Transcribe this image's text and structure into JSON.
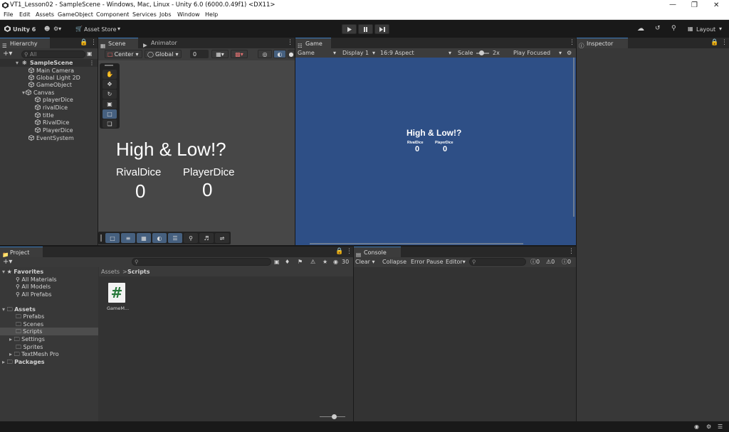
{
  "window": {
    "title": "VT1_Lesson02 - SampleScene - Windows, Mac, Linux - Unity 6.0 (6000.0.49f1) <DX11>"
  },
  "menu": [
    "File",
    "Edit",
    "Assets",
    "GameObject",
    "Component",
    "Services",
    "Jobs",
    "Window",
    "Help"
  ],
  "toolbar": {
    "unity_label": "Unity 6",
    "asset_store_label": "Asset Store",
    "layout_label": "Layout"
  },
  "hierarchy": {
    "tab_label": "Hierarchy",
    "search_placeholder": "All",
    "scene_name": "SampleScene",
    "items": [
      "Main Camera",
      "Global Light 2D",
      "GameObject",
      "Canvas",
      "playerDice",
      "rivalDice",
      "title",
      "RivalDice",
      "PlayerDice",
      "EventSystem"
    ]
  },
  "scene": {
    "tab_label": "Scene",
    "pivot_label": "Center",
    "space_label": "Global",
    "grid_value": "0",
    "title_text": "High & Low!?",
    "rival_label": "RivalDice",
    "player_label": "PlayerDice",
    "rival_value": "0",
    "player_value": "0"
  },
  "animator": {
    "tab_label": "Animator"
  },
  "game": {
    "tab_label": "Game",
    "mode_label": "Game",
    "display_label": "Display 1",
    "aspect_label": "16:9 Aspect",
    "scale_label": "Scale",
    "scale_value": "2x",
    "play_focus_label": "Play Focused",
    "bg_color": "#2e4f86"
  },
  "inspector": {
    "tab_label": "Inspector"
  },
  "project": {
    "tab_label": "Project",
    "hidden_count": "30",
    "breadcrumb_root": "Assets",
    "breadcrumb_sep": ">",
    "breadcrumb_current": "Scripts",
    "favorites_label": "Favorites",
    "favorites": [
      "All Materials",
      "All Models",
      "All Prefabs"
    ],
    "assets_label": "Assets",
    "asset_folders": [
      "Prefabs",
      "Scenes",
      "Scripts",
      "Settings",
      "Sprites",
      "TextMesh Pro"
    ],
    "packages_label": "Packages",
    "file_name": "GameM..."
  },
  "console": {
    "tab_label": "Console",
    "clear_label": "Clear",
    "collapse_label": "Collapse",
    "error_pause_label": "Error Pause",
    "editor_label": "Editor",
    "log_count": "0",
    "warn_count": "0",
    "error_count": "0"
  }
}
